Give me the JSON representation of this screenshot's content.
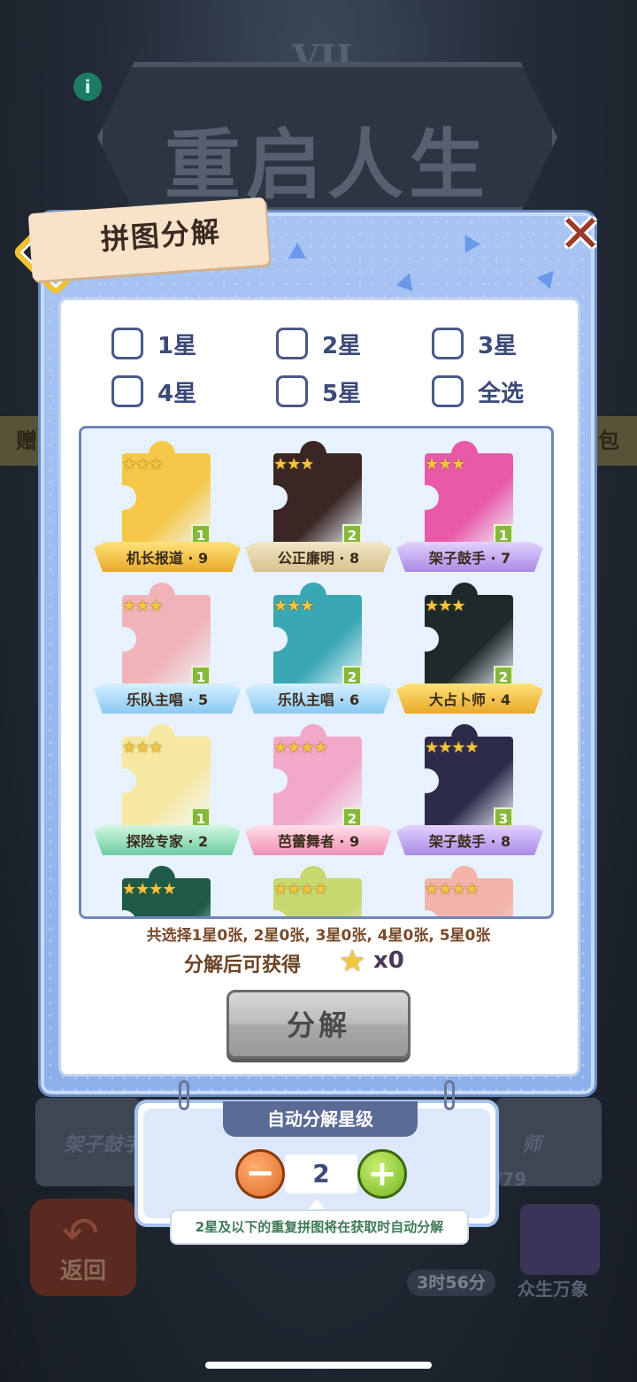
{
  "background": {
    "title": "重启人生",
    "clock_numeral": "VII",
    "left_tag": "赠",
    "right_tag": "包",
    "card_left_label": "架子鼓手",
    "card_right_label": "师",
    "progress_text": "/79",
    "return_label": "返回",
    "timer": "3时56分",
    "book_label": "众生万象"
  },
  "dialog": {
    "title": "拼图分解",
    "close_symbol": "✕",
    "filters": [
      {
        "label": "1星",
        "checked": false
      },
      {
        "label": "2星",
        "checked": false
      },
      {
        "label": "3星",
        "checked": false
      },
      {
        "label": "4星",
        "checked": false
      },
      {
        "label": "5星",
        "checked": false
      },
      {
        "label": "全选",
        "checked": false
      }
    ],
    "pieces": [
      {
        "label": "机长报道 · 9",
        "stars": "★★★",
        "count": "1",
        "ribbon": "gold",
        "art": "#f5c84a"
      },
      {
        "label": "公正廉明 · 8",
        "stars": "★★★",
        "count": "2",
        "ribbon": "tan",
        "art": "#3a2624"
      },
      {
        "label": "架子鼓手 · 7",
        "stars": "★★★",
        "count": "1",
        "ribbon": "purple",
        "art": "#e85aa8"
      },
      {
        "label": "乐队主唱 · 5",
        "stars": "★★★",
        "count": "1",
        "ribbon": "blue",
        "art": "#f0b4b8"
      },
      {
        "label": "乐队主唱 · 6",
        "stars": "★★★",
        "count": "2",
        "ribbon": "blue",
        "art": "#3aa8b4"
      },
      {
        "label": "大占卜师 · 4",
        "stars": "★★★",
        "count": "2",
        "ribbon": "gold",
        "art": "#1e2a2a"
      },
      {
        "label": "探险专家 · 2",
        "stars": "★★★",
        "count": "1",
        "ribbon": "green",
        "art": "#f6e8a0"
      },
      {
        "label": "芭蕾舞者 · 9",
        "stars": "★★★★",
        "count": "2",
        "ribbon": "pink",
        "art": "#f2a8c8"
      },
      {
        "label": "架子鼓手 · 8",
        "stars": "★★★★",
        "count": "3",
        "ribbon": "purple",
        "art": "#2c2c4a"
      },
      {
        "label": "",
        "stars": "★★★★",
        "count": "",
        "ribbon": "",
        "art": "#1f5a48"
      },
      {
        "label": "",
        "stars": "★★★★",
        "count": "",
        "ribbon": "",
        "art": "#c8d870"
      },
      {
        "label": "",
        "stars": "★★★★",
        "count": "",
        "ribbon": "",
        "art": "#f2b4a8"
      }
    ],
    "summary": "共选择1星0张, 2星0张, 3星0张, 4星0张, 5星0张",
    "gain_label": "分解后可获得",
    "gain_count": "x0",
    "decompose_label": "分解"
  },
  "auto": {
    "title": "自动分解星级",
    "minus": "−",
    "plus": "+",
    "level": "2",
    "tip": "2星及以下的重复拼图将在获取时自动分解"
  }
}
